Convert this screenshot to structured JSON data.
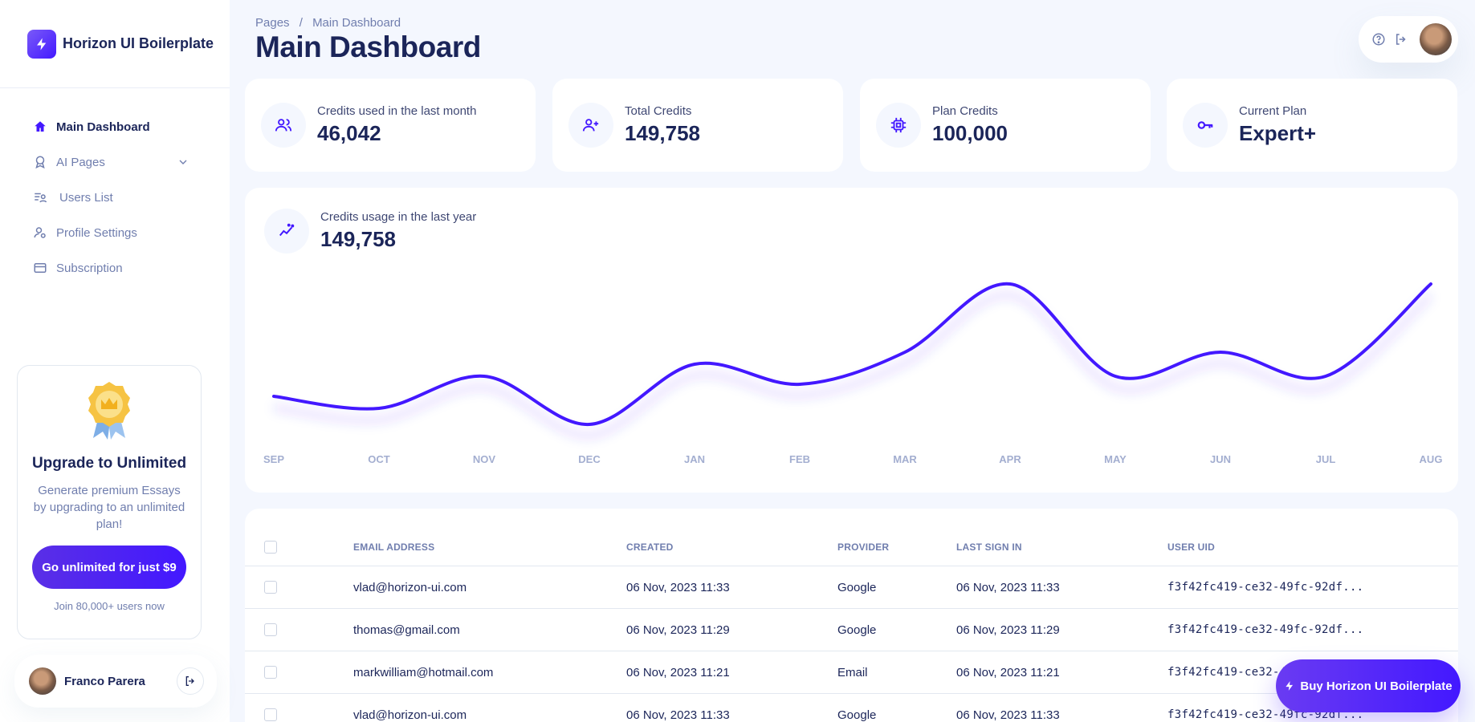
{
  "app": {
    "name": "Horizon UI Boilerplate"
  },
  "sidebar": {
    "items": [
      {
        "label": "Main Dashboard",
        "icon": "home-icon",
        "active": true
      },
      {
        "label": "AI Pages",
        "icon": "ai-badge-icon",
        "expandable": true
      },
      {
        "label": "Users List",
        "icon": "users-list-icon"
      },
      {
        "label": "Profile Settings",
        "icon": "user-settings-icon"
      },
      {
        "label": "Subscription",
        "icon": "credit-card-icon"
      }
    ],
    "upgrade": {
      "title": "Upgrade to Unlimited",
      "description": "Generate premium Essays by upgrading to an unlimited plan!",
      "cta": "Go unlimited for just $9",
      "footnote": "Join 80,000+ users now"
    },
    "user": {
      "name": "Franco Parera"
    }
  },
  "header": {
    "breadcrumb": {
      "root": "Pages",
      "separator": "/",
      "current": "Main Dashboard"
    },
    "title": "Main Dashboard"
  },
  "stats": [
    {
      "label": "Credits used in the last month",
      "value": "46,042",
      "icon": "users-icon"
    },
    {
      "label": "Total Credits",
      "value": "149,758",
      "icon": "add-user-icon"
    },
    {
      "label": "Plan Credits",
      "value": "100,000",
      "icon": "chip-icon"
    },
    {
      "label": "Current Plan",
      "value": "Expert+",
      "icon": "key-icon"
    }
  ],
  "usage": {
    "label": "Credits usage in the last year",
    "value": "149,758"
  },
  "chart_data": {
    "type": "line",
    "title": "Credits usage in the last year",
    "categories": [
      "SEP",
      "OCT",
      "NOV",
      "DEC",
      "JAN",
      "FEB",
      "MAR",
      "APR",
      "MAY",
      "JUN",
      "JUL",
      "AUG"
    ],
    "series": [
      {
        "values": [
          48,
          45,
          53,
          41,
          56,
          51,
          59,
          76,
          53,
          59,
          53,
          76
        ]
      }
    ],
    "ylim": [
      30,
      80
    ],
    "grid": false,
    "color": "#4318ff"
  },
  "table": {
    "columns": [
      "EMAIL ADDRESS",
      "CREATED",
      "PROVIDER",
      "LAST SIGN IN",
      "USER UID"
    ],
    "rows": [
      {
        "email": "vlad@horizon-ui.com",
        "created": "06 Nov, 2023 11:33",
        "provider": "Google",
        "last_sign_in": "06 Nov, 2023 11:33",
        "uid": "f3f42fc419-ce32-49fc-92df..."
      },
      {
        "email": "thomas@gmail.com",
        "created": "06 Nov, 2023 11:29",
        "provider": "Google",
        "last_sign_in": "06 Nov, 2023 11:29",
        "uid": "f3f42fc419-ce32-49fc-92df..."
      },
      {
        "email": "markwilliam@hotmail.com",
        "created": "06 Nov, 2023 11:21",
        "provider": "Email",
        "last_sign_in": "06 Nov, 2023 11:21",
        "uid": "f3f42fc419-ce32-49fc-92df..."
      },
      {
        "email": "vlad@horizon-ui.com",
        "created": "06 Nov, 2023 11:33",
        "provider": "Google",
        "last_sign_in": "06 Nov, 2023 11:33",
        "uid": "f3f42fc419-ce32-49fc-92df..."
      }
    ]
  },
  "buy_button": {
    "label": "Buy Horizon UI Boilerplate"
  },
  "colors": {
    "brand": "#4318ff",
    "text": "#1b2559",
    "muted": "#707eae",
    "background": "#f4f7fe"
  }
}
